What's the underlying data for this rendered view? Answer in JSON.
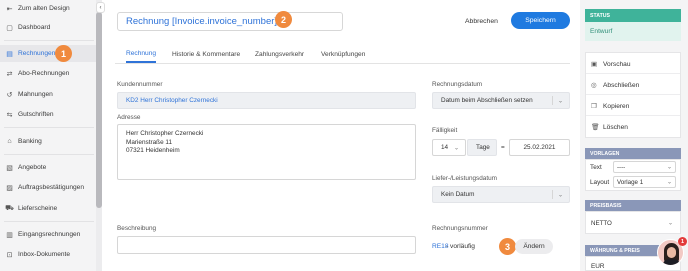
{
  "sidebar": {
    "items": [
      {
        "label": "Zum alten Design",
        "icon": "back-arrow-icon"
      },
      {
        "label": "Dashboard",
        "icon": "dashboard-icon"
      },
      {
        "label": "Rechnungen",
        "icon": "invoice-icon"
      },
      {
        "label": "Abo-Rechnungen",
        "icon": "subscription-icon"
      },
      {
        "label": "Mahnungen",
        "icon": "reminder-icon"
      },
      {
        "label": "Gutschriften",
        "icon": "credit-note-icon"
      },
      {
        "label": "Banking",
        "icon": "bank-icon"
      },
      {
        "label": "Angebote",
        "icon": "offer-icon"
      },
      {
        "label": "Auftragsbestätigungen",
        "icon": "order-confirmation-icon"
      },
      {
        "label": "Lieferscheine",
        "icon": "delivery-note-icon"
      },
      {
        "label": "Eingangsrechnungen",
        "icon": "incoming-invoice-icon"
      },
      {
        "label": "Inbox-Dokumente",
        "icon": "inbox-icon"
      }
    ]
  },
  "badges": {
    "one": "1",
    "two": "2",
    "three": "3"
  },
  "header": {
    "title": "Rechnung [Invoice.invoice_number]",
    "cancel_label": "Abbrechen",
    "save_label": "Speichern"
  },
  "tabs": [
    "Rechnung",
    "Historie & Kommentare",
    "Zahlungsverkehr",
    "Verknüpfungen"
  ],
  "form": {
    "customer_number_label": "Kundennummer",
    "customer_number_value": "KD2 Herr Christopher Czernecki",
    "address_label": "Adresse",
    "address_lines": [
      "Herr Christopher Czernecki",
      "Marienstraße 11",
      "07321 Heidenheim"
    ],
    "description_label": "Beschreibung",
    "invoice_date_label": "Rechnungsdatum",
    "invoice_date_value": "Datum beim Abschließen setzen",
    "due_label": "Fälligkeit",
    "due_days": "14",
    "due_unit": "Tage",
    "due_equals": "=",
    "due_date": "25.02.2021",
    "delivery_label": "Liefer-/Leistungsdatum",
    "delivery_value": "Kein Datum",
    "invoice_number_label": "Rechnungsnummer",
    "invoice_number_value": "RE18",
    "invoice_number_suffix": "- vorläufig",
    "change_label": "Ändern"
  },
  "right_panel": {
    "status_heading": "STATUS",
    "status_value": "Entwurf",
    "actions": [
      {
        "label": "Vorschau",
        "icon": "preview-icon"
      },
      {
        "label": "Abschließen",
        "icon": "check-circle-icon"
      },
      {
        "label": "Kopieren",
        "icon": "copy-icon"
      },
      {
        "label": "Löschen",
        "icon": "trash-icon"
      }
    ],
    "templates_heading": "VORLAGEN",
    "text_label": "Text",
    "text_value": "----",
    "layout_label": "Layout",
    "layout_value": "Vorlage 1",
    "price_heading": "PREISBASIS",
    "price_value": "NETTO",
    "currency_heading": "WÄHRUNG & PREIS",
    "currency_value": "EUR",
    "notification_count": "1"
  },
  "colors": {
    "accent": "#2f73d8",
    "save": "#1f7ae0",
    "badge": "#f08a3e",
    "status": "#3fb39a"
  }
}
